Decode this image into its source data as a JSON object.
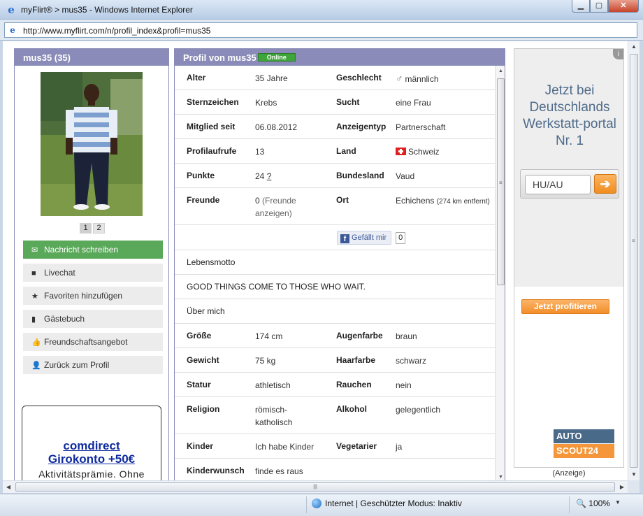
{
  "window": {
    "title": "myFlirt® > mus35 - Windows Internet Explorer",
    "url": "http://www.myflirt.com/n/profil_index&profil=mus35"
  },
  "left": {
    "header": "mus35 (35)",
    "pages": [
      "1",
      "2"
    ],
    "actions": [
      {
        "label": "Nachricht schreiben",
        "icon": "envelope-icon"
      },
      {
        "label": "Livechat",
        "icon": "camera-icon"
      },
      {
        "label": "Favoriten hinzufügen",
        "icon": "star-icon"
      },
      {
        "label": "Gästebuch",
        "icon": "book-icon"
      },
      {
        "label": "Freundschaftsangebot",
        "icon": "thumbs-up-icon"
      },
      {
        "label": "Zurück zum Profil",
        "icon": "person-icon"
      }
    ],
    "ad": {
      "title_line1": "comdirect",
      "title_line2": "Girokonto +50€",
      "text": "Aktivitätsprämie. Ohne"
    }
  },
  "profile": {
    "header": "Profil von mus35",
    "status": "Online",
    "rows": [
      {
        "l1": "Alter",
        "v1": "35 Jahre",
        "l2": "Geschlecht",
        "v2": "männlich"
      },
      {
        "l1": "Sternzeichen",
        "v1": "Krebs",
        "l2": "Sucht",
        "v2": "eine Frau"
      },
      {
        "l1": "Mitglied seit",
        "v1": "06.08.2012",
        "l2": "Anzeigentyp",
        "v2": "Partnerschaft"
      },
      {
        "l1": "Profilaufrufe",
        "v1": "13",
        "l2": "Land",
        "v2": "Schweiz"
      },
      {
        "l1": "Punkte",
        "v1": "24",
        "v1_link": "?",
        "l2": "Bundesland",
        "v2": "Vaud"
      },
      {
        "l1": "Freunde",
        "v1": "0",
        "v1_link": "(Freunde anzeigen)",
        "l2": "Ort",
        "v2": "Echichens",
        "v2_small": "(274 km entfernt)"
      }
    ],
    "facebook": {
      "label": "Gefällt mir",
      "count": "0"
    },
    "motto_label": "Lebensmotto",
    "motto": "GOOD THINGS COME TO THOSE WHO WAIT.",
    "about_label": "Über mich",
    "rows2": [
      {
        "l1": "Größe",
        "v1": "174 cm",
        "l2": "Augenfarbe",
        "v2": "braun"
      },
      {
        "l1": "Gewicht",
        "v1": "75 kg",
        "l2": "Haarfarbe",
        "v2": "schwarz"
      },
      {
        "l1": "Statur",
        "v1": "athletisch",
        "l2": "Rauchen",
        "v2": "nein"
      },
      {
        "l1": "Religion",
        "v1": "römisch-katholisch",
        "l2": "Alkohol",
        "v2": "gelegentlich"
      },
      {
        "l1": "Kinder",
        "v1": "Ich habe Kinder",
        "l2": "Vegetarier",
        "v2": "ja"
      },
      {
        "l1": "Kinderwunsch",
        "v1": "finde es raus",
        "l2": "",
        "v2": ""
      }
    ]
  },
  "right_ad": {
    "headline": "Jetzt bei Deutschlands Werkstatt-portal Nr. 1",
    "input_value": "HU/AU",
    "cta": "Jetzt profitieren",
    "logo_top": "AUTO",
    "logo_bottom": "SCOUT24",
    "anzeige": "(Anzeige)"
  },
  "status_bar": {
    "zone": "Internet | Geschützter Modus: Inaktiv",
    "zoom": "100%"
  },
  "colors": {
    "panel_header": "#8a8bb8",
    "primary_action": "#5aa85a",
    "online_badge": "#3fa53a",
    "cta_orange": "#f28e2b"
  }
}
